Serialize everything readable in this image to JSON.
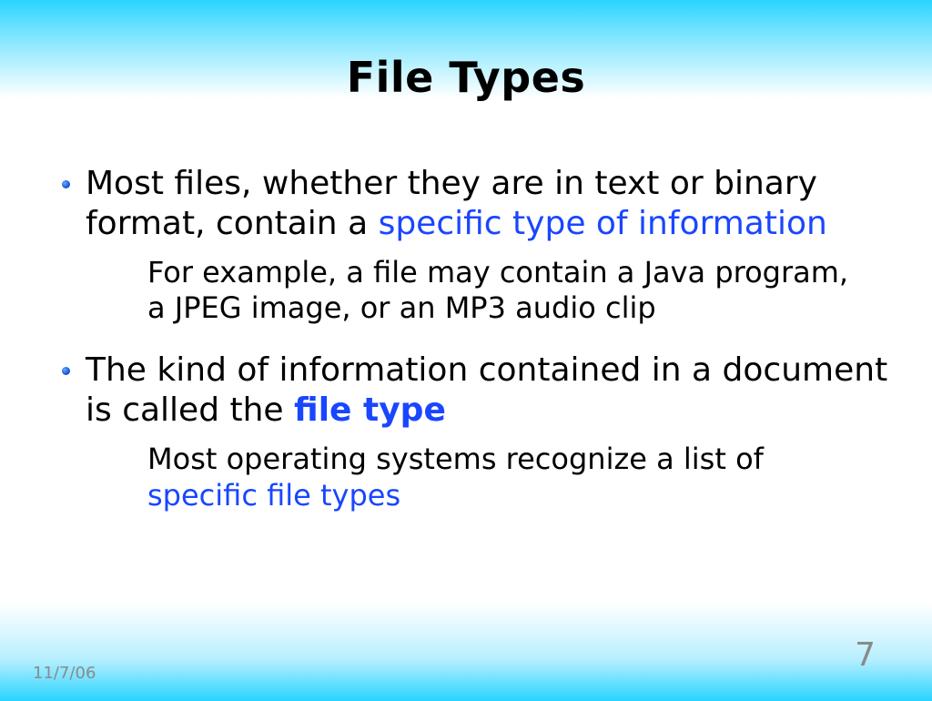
{
  "title": "File Types",
  "bullets": [
    {
      "main_pre": "Most files, whether they are in text or binary format, contain a ",
      "main_blue": "specific type of information",
      "main_bluebold": "",
      "main_post": "",
      "sub_pre": "For example, a file may contain a Java program, a JPEG image, or an MP3 audio clip",
      "sub_blue": "",
      "sub_post": ""
    },
    {
      "main_pre": "The kind of information contained in a document is called the ",
      "main_blue": "",
      "main_bluebold": "file type",
      "main_post": "",
      "sub_pre": "Most operating systems recognize a list of ",
      "sub_blue": "specific file types",
      "sub_post": ""
    }
  ],
  "footer": {
    "date": "11/7/06",
    "page": "7"
  }
}
